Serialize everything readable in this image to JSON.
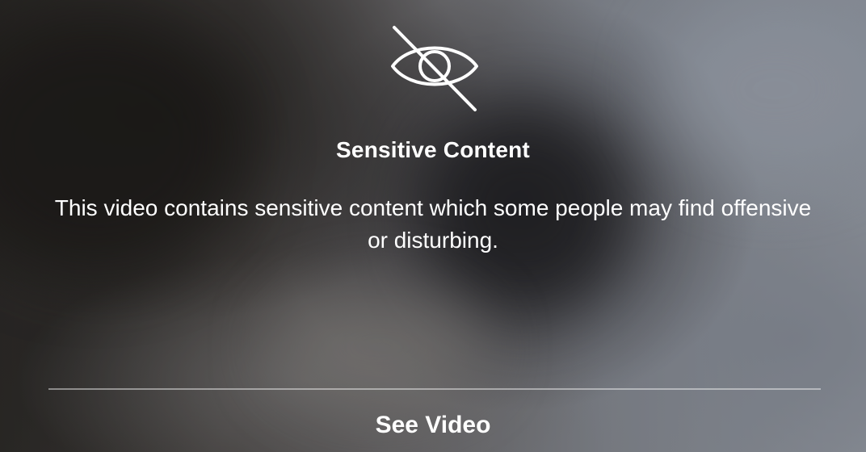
{
  "warning": {
    "icon": "eye-slash-icon",
    "title": "Sensitive Content",
    "description": "This video contains sensitive content which some people may find offensive or disturbing.",
    "action_label": "See Video"
  }
}
